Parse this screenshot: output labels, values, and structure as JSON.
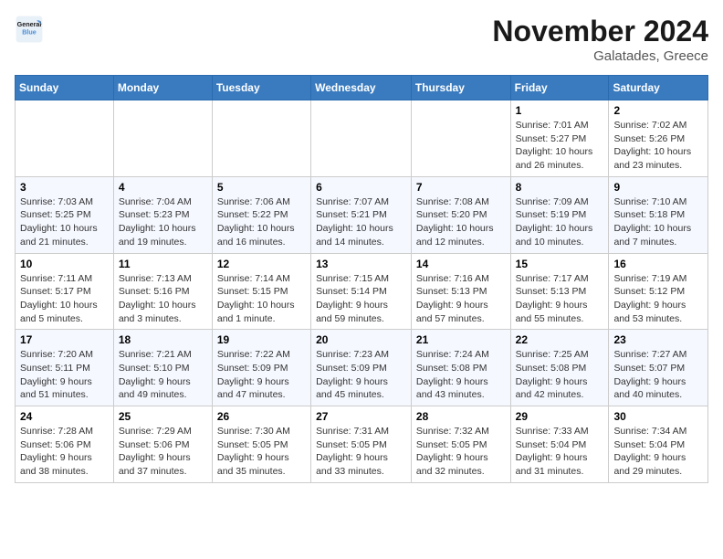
{
  "header": {
    "logo_line1": "General",
    "logo_line2": "Blue",
    "month": "November 2024",
    "location": "Galatades, Greece"
  },
  "weekdays": [
    "Sunday",
    "Monday",
    "Tuesday",
    "Wednesday",
    "Thursday",
    "Friday",
    "Saturday"
  ],
  "weeks": [
    [
      {
        "day": "",
        "info": ""
      },
      {
        "day": "",
        "info": ""
      },
      {
        "day": "",
        "info": ""
      },
      {
        "day": "",
        "info": ""
      },
      {
        "day": "",
        "info": ""
      },
      {
        "day": "1",
        "info": "Sunrise: 7:01 AM\nSunset: 5:27 PM\nDaylight: 10 hours and 26 minutes."
      },
      {
        "day": "2",
        "info": "Sunrise: 7:02 AM\nSunset: 5:26 PM\nDaylight: 10 hours and 23 minutes."
      }
    ],
    [
      {
        "day": "3",
        "info": "Sunrise: 7:03 AM\nSunset: 5:25 PM\nDaylight: 10 hours and 21 minutes."
      },
      {
        "day": "4",
        "info": "Sunrise: 7:04 AM\nSunset: 5:23 PM\nDaylight: 10 hours and 19 minutes."
      },
      {
        "day": "5",
        "info": "Sunrise: 7:06 AM\nSunset: 5:22 PM\nDaylight: 10 hours and 16 minutes."
      },
      {
        "day": "6",
        "info": "Sunrise: 7:07 AM\nSunset: 5:21 PM\nDaylight: 10 hours and 14 minutes."
      },
      {
        "day": "7",
        "info": "Sunrise: 7:08 AM\nSunset: 5:20 PM\nDaylight: 10 hours and 12 minutes."
      },
      {
        "day": "8",
        "info": "Sunrise: 7:09 AM\nSunset: 5:19 PM\nDaylight: 10 hours and 10 minutes."
      },
      {
        "day": "9",
        "info": "Sunrise: 7:10 AM\nSunset: 5:18 PM\nDaylight: 10 hours and 7 minutes."
      }
    ],
    [
      {
        "day": "10",
        "info": "Sunrise: 7:11 AM\nSunset: 5:17 PM\nDaylight: 10 hours and 5 minutes."
      },
      {
        "day": "11",
        "info": "Sunrise: 7:13 AM\nSunset: 5:16 PM\nDaylight: 10 hours and 3 minutes."
      },
      {
        "day": "12",
        "info": "Sunrise: 7:14 AM\nSunset: 5:15 PM\nDaylight: 10 hours and 1 minute."
      },
      {
        "day": "13",
        "info": "Sunrise: 7:15 AM\nSunset: 5:14 PM\nDaylight: 9 hours and 59 minutes."
      },
      {
        "day": "14",
        "info": "Sunrise: 7:16 AM\nSunset: 5:13 PM\nDaylight: 9 hours and 57 minutes."
      },
      {
        "day": "15",
        "info": "Sunrise: 7:17 AM\nSunset: 5:13 PM\nDaylight: 9 hours and 55 minutes."
      },
      {
        "day": "16",
        "info": "Sunrise: 7:19 AM\nSunset: 5:12 PM\nDaylight: 9 hours and 53 minutes."
      }
    ],
    [
      {
        "day": "17",
        "info": "Sunrise: 7:20 AM\nSunset: 5:11 PM\nDaylight: 9 hours and 51 minutes."
      },
      {
        "day": "18",
        "info": "Sunrise: 7:21 AM\nSunset: 5:10 PM\nDaylight: 9 hours and 49 minutes."
      },
      {
        "day": "19",
        "info": "Sunrise: 7:22 AM\nSunset: 5:09 PM\nDaylight: 9 hours and 47 minutes."
      },
      {
        "day": "20",
        "info": "Sunrise: 7:23 AM\nSunset: 5:09 PM\nDaylight: 9 hours and 45 minutes."
      },
      {
        "day": "21",
        "info": "Sunrise: 7:24 AM\nSunset: 5:08 PM\nDaylight: 9 hours and 43 minutes."
      },
      {
        "day": "22",
        "info": "Sunrise: 7:25 AM\nSunset: 5:08 PM\nDaylight: 9 hours and 42 minutes."
      },
      {
        "day": "23",
        "info": "Sunrise: 7:27 AM\nSunset: 5:07 PM\nDaylight: 9 hours and 40 minutes."
      }
    ],
    [
      {
        "day": "24",
        "info": "Sunrise: 7:28 AM\nSunset: 5:06 PM\nDaylight: 9 hours and 38 minutes."
      },
      {
        "day": "25",
        "info": "Sunrise: 7:29 AM\nSunset: 5:06 PM\nDaylight: 9 hours and 37 minutes."
      },
      {
        "day": "26",
        "info": "Sunrise: 7:30 AM\nSunset: 5:05 PM\nDaylight: 9 hours and 35 minutes."
      },
      {
        "day": "27",
        "info": "Sunrise: 7:31 AM\nSunset: 5:05 PM\nDaylight: 9 hours and 33 minutes."
      },
      {
        "day": "28",
        "info": "Sunrise: 7:32 AM\nSunset: 5:05 PM\nDaylight: 9 hours and 32 minutes."
      },
      {
        "day": "29",
        "info": "Sunrise: 7:33 AM\nSunset: 5:04 PM\nDaylight: 9 hours and 31 minutes."
      },
      {
        "day": "30",
        "info": "Sunrise: 7:34 AM\nSunset: 5:04 PM\nDaylight: 9 hours and 29 minutes."
      }
    ]
  ]
}
